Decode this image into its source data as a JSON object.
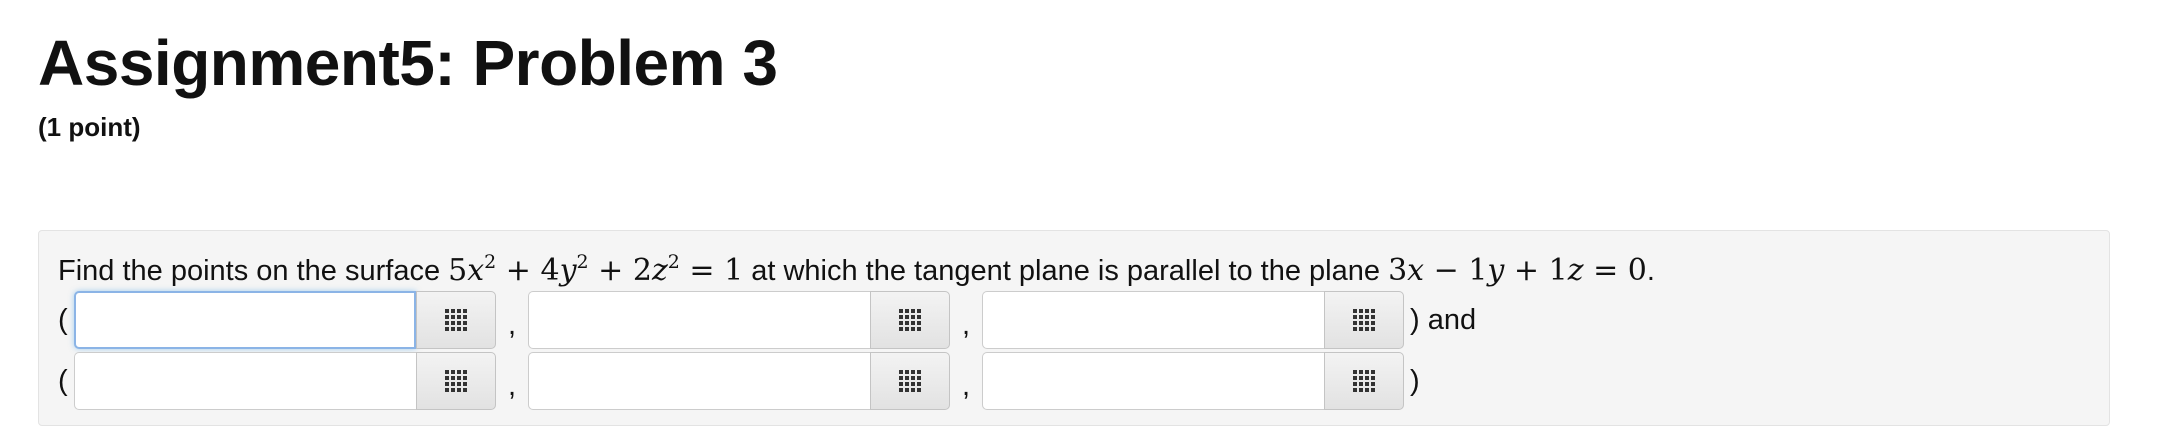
{
  "header": {
    "title": "Assignment5: Problem 3",
    "points": "(1 point)"
  },
  "problem": {
    "text_before": "Find the points on the surface ",
    "surface_equation": {
      "t1_coef": "5",
      "t1_var": "x",
      "t1_exp": "2",
      "op1": "+",
      "t2_coef": "4",
      "t2_var": "y",
      "t2_exp": "2",
      "op2": "+",
      "t3_coef": "2",
      "t3_var": "z",
      "t3_exp": "2",
      "eq": "=",
      "rhs": "1"
    },
    "text_middle": " at which the tangent plane is parallel to the plane ",
    "plane_equation": {
      "t1_coef": "3",
      "t1_var": "x",
      "op1": "−",
      "t2_coef": "1",
      "t2_var": "y",
      "op2": "+",
      "t3_coef": "1",
      "t3_var": "z",
      "eq": "=",
      "rhs": "0"
    },
    "text_end": "."
  },
  "answers": {
    "open_paren": "(",
    "comma": ",",
    "row1_trailing": ") and",
    "row2_trailing": ")",
    "row1": [
      {
        "value": "",
        "placeholder": ""
      },
      {
        "value": "",
        "placeholder": ""
      },
      {
        "value": "",
        "placeholder": ""
      }
    ],
    "row2": [
      {
        "value": "",
        "placeholder": ""
      },
      {
        "value": "",
        "placeholder": ""
      },
      {
        "value": "",
        "placeholder": ""
      }
    ],
    "palette_icon": "grid-icon"
  },
  "colors": {
    "focus_border": "#8bb4e6",
    "panel_background": "#f5f5f5"
  }
}
